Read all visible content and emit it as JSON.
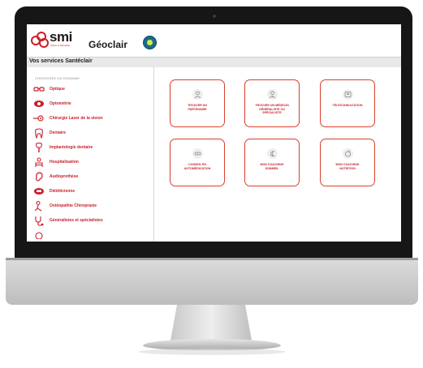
{
  "brand": {
    "logo_text": "smi",
    "logo_sub": "Santé et Mutualité",
    "app_name": "Géoclair"
  },
  "services_title": "Vos services Santéclair",
  "sidebar": {
    "heading": "CHOISISSEZ UN DOMAINE",
    "items": [
      {
        "label": "Optique",
        "icon": "glasses-icon"
      },
      {
        "label": "Optométrie",
        "icon": "eye-icon"
      },
      {
        "label": "Chirurgie Laser de la vision",
        "icon": "laser-eye-icon"
      },
      {
        "label": "Dentaire",
        "icon": "tooth-icon"
      },
      {
        "label": "Implantologie dentaire",
        "icon": "dental-implant-icon"
      },
      {
        "label": "Hospitalisation",
        "icon": "hospital-bed-icon"
      },
      {
        "label": "Audioprothèse",
        "icon": "ear-icon"
      },
      {
        "label": "Diététicienne",
        "icon": "scale-icon"
      },
      {
        "label": "Ostéopathie Chiropraxie",
        "icon": "spine-icon"
      },
      {
        "label": "Généralistes et spécialistes",
        "icon": "stethoscope-icon"
      }
    ]
  },
  "tiles": [
    {
      "label": "TROUVER UN\nPARTENAIRE",
      "icon": "partner-location-icon"
    },
    {
      "label": "TROUVER UN MÉDECIN\nGÉNÉRALISTE OU\nSPÉCIALISTE",
      "icon": "doctor-icon"
    },
    {
      "label": "TÉLÉCONSULTATION",
      "icon": "video-consult-icon"
    },
    {
      "label": "CONSEIL EN\nAUTOMÉDICATION",
      "icon": "pill-icon"
    },
    {
      "label": "MON COACHING\nSOMMEIL",
      "icon": "sleep-icon"
    },
    {
      "label": "MON COACHING\nNUTRITION",
      "icon": "nutrition-icon"
    }
  ],
  "colors": {
    "accent": "#c8202a",
    "tile_border": "#d9402c",
    "bezel": "#161616"
  }
}
